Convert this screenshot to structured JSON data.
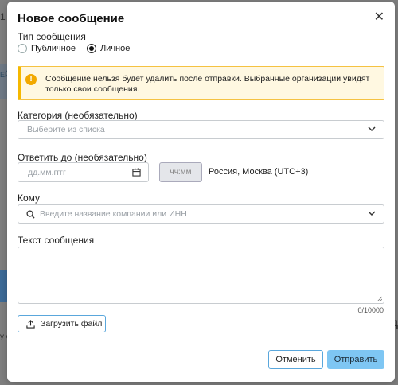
{
  "background": {
    "top_left_fragment": "1",
    "left_tab_fragment": "ЕЙ",
    "right_fragment": "д",
    "left_bottom_fragment": "у о"
  },
  "modal": {
    "title": "Новое сообщение",
    "close_icon": "close-icon"
  },
  "message_type": {
    "label": "Тип сообщения",
    "options": [
      {
        "label": "Публичное",
        "checked": false
      },
      {
        "label": "Личное",
        "checked": true
      }
    ]
  },
  "warning": {
    "icon": "warning-icon",
    "text": "Сообщение нельзя будет удалить после отправки. Выбранные организации увидят только свои сообщения."
  },
  "category": {
    "label": "Категория (необязательно)",
    "placeholder": "Выберите из списка"
  },
  "reply_by": {
    "label": "Ответить до (необязательно)",
    "date_placeholder": "дд.мм.гггг",
    "time_placeholder": "чч:мм",
    "timezone": "Россия, Москва (UTC+3)"
  },
  "recipient": {
    "label": "Кому",
    "placeholder": "Введите название компании или ИНН"
  },
  "message_text": {
    "label": "Текст сообщения",
    "counter": "0/10000"
  },
  "upload": {
    "label": "Загрузить файл"
  },
  "actions": {
    "cancel": "Отменить",
    "send": "Отправить"
  },
  "colors": {
    "accent": "#5aa7dc",
    "primary_button": "#7ec6f3",
    "warning_border": "#f5b800",
    "warning_bg": "#fff8e1"
  }
}
